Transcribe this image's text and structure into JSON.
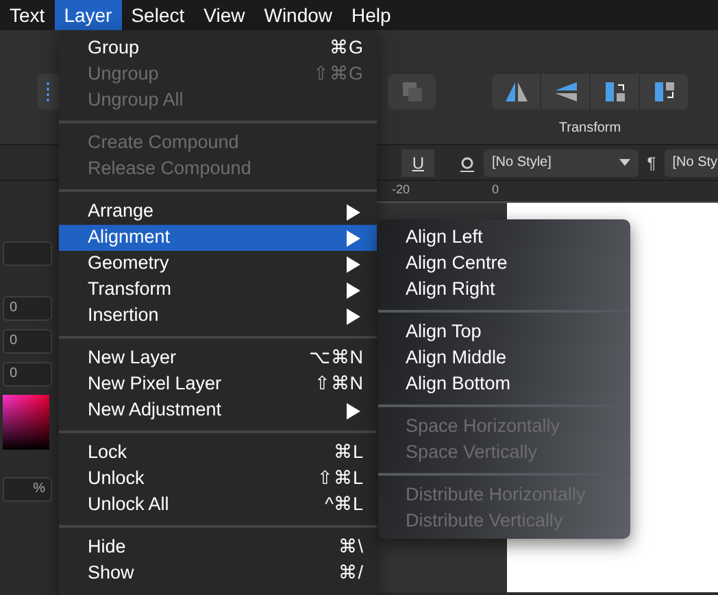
{
  "menubar": [
    {
      "label": "Text",
      "selected": false
    },
    {
      "label": "Layer",
      "selected": true
    },
    {
      "label": "Select",
      "selected": false
    },
    {
      "label": "View",
      "selected": false
    },
    {
      "label": "Window",
      "selected": false
    },
    {
      "label": "Help",
      "selected": false
    }
  ],
  "toolbar": {
    "transform_label": "Transform"
  },
  "context_bar": {
    "underline_button": "U",
    "character_style": "[No Style]",
    "paragraph_symbol": "¶",
    "paragraph_style": "[No Sty"
  },
  "ruler": {
    "labels": [
      "-20",
      "0"
    ]
  },
  "left_panel": {
    "fields": [
      "0",
      "0",
      "0"
    ],
    "opacity": "%"
  },
  "layer_menu": [
    {
      "kind": "item",
      "label": "Group",
      "shortcut": "⌘G",
      "disabled": false,
      "submenu": false,
      "selected": false
    },
    {
      "kind": "item",
      "label": "Ungroup",
      "shortcut": "⇧⌘G",
      "disabled": true,
      "submenu": false,
      "selected": false
    },
    {
      "kind": "item",
      "label": "Ungroup All",
      "disabled": true,
      "submenu": false,
      "selected": false
    },
    {
      "kind": "separator"
    },
    {
      "kind": "item",
      "label": "Create Compound",
      "disabled": true,
      "submenu": false,
      "selected": false
    },
    {
      "kind": "item",
      "label": "Release Compound",
      "disabled": true,
      "submenu": false,
      "selected": false
    },
    {
      "kind": "separator"
    },
    {
      "kind": "item",
      "label": "Arrange",
      "disabled": false,
      "submenu": true,
      "selected": false
    },
    {
      "kind": "item",
      "label": "Alignment",
      "disabled": false,
      "submenu": true,
      "selected": true
    },
    {
      "kind": "item",
      "label": "Geometry",
      "disabled": false,
      "submenu": true,
      "selected": false
    },
    {
      "kind": "item",
      "label": "Transform",
      "disabled": false,
      "submenu": true,
      "selected": false
    },
    {
      "kind": "item",
      "label": "Insertion",
      "disabled": false,
      "submenu": true,
      "selected": false
    },
    {
      "kind": "separator"
    },
    {
      "kind": "item",
      "label": "New Layer",
      "shortcut": "⌥⌘N",
      "disabled": false,
      "submenu": false,
      "selected": false
    },
    {
      "kind": "item",
      "label": "New Pixel Layer",
      "shortcut": "⇧⌘N",
      "disabled": false,
      "submenu": false,
      "selected": false
    },
    {
      "kind": "item",
      "label": "New Adjustment",
      "disabled": false,
      "submenu": true,
      "selected": false
    },
    {
      "kind": "separator"
    },
    {
      "kind": "item",
      "label": "Lock",
      "shortcut": "⌘L",
      "disabled": false,
      "submenu": false,
      "selected": false
    },
    {
      "kind": "item",
      "label": "Unlock",
      "shortcut": "⇧⌘L",
      "disabled": false,
      "submenu": false,
      "selected": false
    },
    {
      "kind": "item",
      "label": "Unlock All",
      "shortcut": "^⌘L",
      "disabled": false,
      "submenu": false,
      "selected": false
    },
    {
      "kind": "separator"
    },
    {
      "kind": "item",
      "label": "Hide",
      "shortcut": "⌘\\",
      "disabled": false,
      "submenu": false,
      "selected": false
    },
    {
      "kind": "item",
      "label": "Show",
      "shortcut": "⌘/",
      "disabled": false,
      "submenu": false,
      "selected": false
    }
  ],
  "alignment_submenu": [
    {
      "kind": "item",
      "label": "Align Left",
      "disabled": false
    },
    {
      "kind": "item",
      "label": "Align Centre",
      "disabled": false
    },
    {
      "kind": "item",
      "label": "Align Right",
      "disabled": false
    },
    {
      "kind": "separator"
    },
    {
      "kind": "item",
      "label": "Align Top",
      "disabled": false
    },
    {
      "kind": "item",
      "label": "Align Middle",
      "disabled": false
    },
    {
      "kind": "item",
      "label": "Align Bottom",
      "disabled": false
    },
    {
      "kind": "separator"
    },
    {
      "kind": "item",
      "label": "Space Horizontally",
      "disabled": true
    },
    {
      "kind": "item",
      "label": "Space Vertically",
      "disabled": true
    },
    {
      "kind": "separator"
    },
    {
      "kind": "item",
      "label": "Distribute Horizontally",
      "disabled": true
    },
    {
      "kind": "item",
      "label": "Distribute Vertically",
      "disabled": true
    }
  ]
}
